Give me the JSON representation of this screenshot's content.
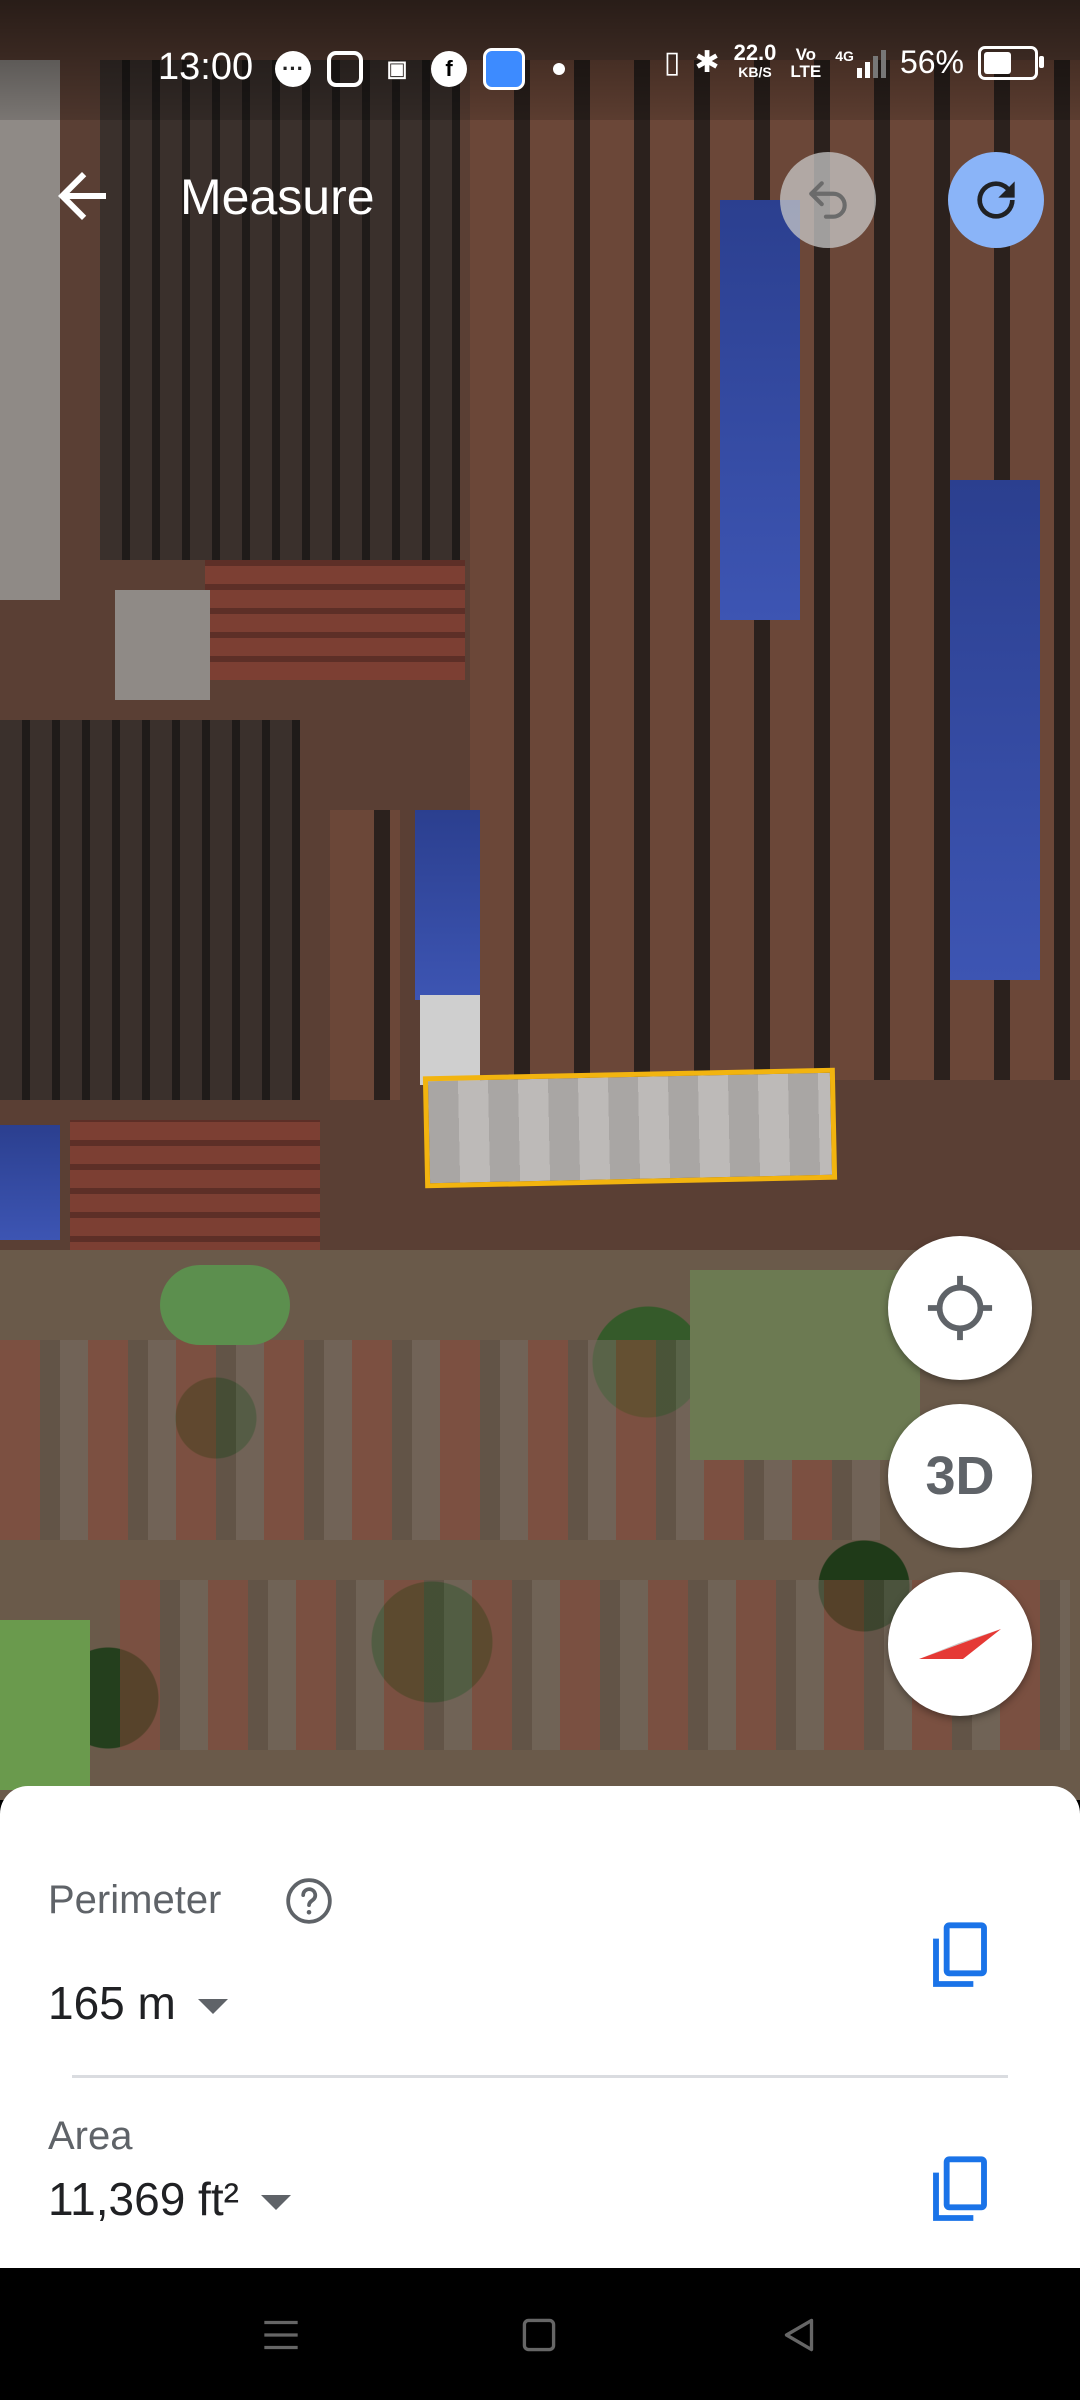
{
  "status_bar": {
    "time": "13:00",
    "app_icons": [
      "chat-icon",
      "instagram-icon",
      "notification-icon",
      "facebook-icon",
      "app-icon",
      "dot-icon"
    ],
    "net_speed_value": "22.0",
    "net_speed_unit": "KB/S",
    "volte_top": "Vo",
    "volte_bottom": "LTE",
    "network": "4G",
    "battery": "56%",
    "battery_level": 0.56
  },
  "app_bar": {
    "title": "Measure"
  },
  "map_controls": {
    "three_d_label": "3D"
  },
  "measurement": {
    "perimeter_label": "Perimeter",
    "perimeter_value": "165 m",
    "area_label": "Area",
    "area_value": "11,369 ft²"
  },
  "colors": {
    "selection_outline": "#f2b40f",
    "accent_blue": "#1a73e8",
    "redo_button": "#8ab4f8"
  }
}
